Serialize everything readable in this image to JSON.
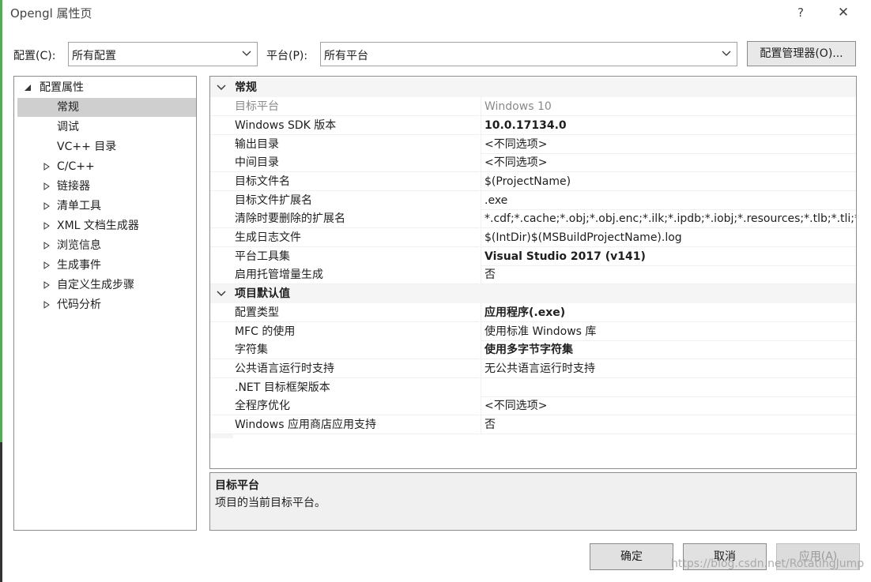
{
  "window": {
    "title": "Opengl 属性页",
    "help_glyph": "?",
    "close_glyph": "✕"
  },
  "config_bar": {
    "config_label": "配置(C):",
    "config_value": "所有配置",
    "platform_label": "平台(P):",
    "platform_value": "所有平台",
    "manager_button": "配置管理器(O)..."
  },
  "tree": {
    "root": "配置属性",
    "items": [
      {
        "label": "常规",
        "selected": true,
        "expandable": false
      },
      {
        "label": "调试",
        "selected": false,
        "expandable": false
      },
      {
        "label": "VC++ 目录",
        "selected": false,
        "expandable": false
      },
      {
        "label": "C/C++",
        "selected": false,
        "expandable": true
      },
      {
        "label": "链接器",
        "selected": false,
        "expandable": true
      },
      {
        "label": "清单工具",
        "selected": false,
        "expandable": true
      },
      {
        "label": "XML 文档生成器",
        "selected": false,
        "expandable": true
      },
      {
        "label": "浏览信息",
        "selected": false,
        "expandable": true
      },
      {
        "label": "生成事件",
        "selected": false,
        "expandable": true
      },
      {
        "label": "自定义生成步骤",
        "selected": false,
        "expandable": true
      },
      {
        "label": "代码分析",
        "selected": false,
        "expandable": true
      }
    ]
  },
  "properties": {
    "categories": [
      {
        "label": "常规",
        "rows": [
          {
            "name": "目标平台",
            "value": "Windows 10",
            "bold": false,
            "disabled": true
          },
          {
            "name": "Windows SDK 版本",
            "value": "10.0.17134.0",
            "bold": true,
            "disabled": false
          },
          {
            "name": "输出目录",
            "value": "<不同选项>",
            "bold": false,
            "disabled": false
          },
          {
            "name": "中间目录",
            "value": "<不同选项>",
            "bold": false,
            "disabled": false
          },
          {
            "name": "目标文件名",
            "value": "$(ProjectName)",
            "bold": false,
            "disabled": false
          },
          {
            "name": "目标文件扩展名",
            "value": ".exe",
            "bold": false,
            "disabled": false
          },
          {
            "name": "清除时要删除的扩展名",
            "value": "*.cdf;*.cache;*.obj;*.obj.enc;*.ilk;*.ipdb;*.iobj;*.resources;*.tlb;*.tli;*.t",
            "bold": false,
            "disabled": false
          },
          {
            "name": "生成日志文件",
            "value": "$(IntDir)$(MSBuildProjectName).log",
            "bold": false,
            "disabled": false
          },
          {
            "name": "平台工具集",
            "value": "Visual Studio 2017 (v141)",
            "bold": true,
            "disabled": false
          },
          {
            "name": "启用托管增量生成",
            "value": "否",
            "bold": false,
            "disabled": false
          }
        ]
      },
      {
        "label": "项目默认值",
        "rows": [
          {
            "name": "配置类型",
            "value": "应用程序(.exe)",
            "bold": true,
            "disabled": false
          },
          {
            "name": "MFC 的使用",
            "value": "使用标准 Windows 库",
            "bold": false,
            "disabled": false
          },
          {
            "name": "字符集",
            "value": "使用多字节字符集",
            "bold": true,
            "disabled": false
          },
          {
            "name": "公共语言运行时支持",
            "value": "无公共语言运行时支持",
            "bold": false,
            "disabled": false
          },
          {
            "name": ".NET 目标框架版本",
            "value": "",
            "bold": false,
            "disabled": false
          },
          {
            "name": "全程序优化",
            "value": "<不同选项>",
            "bold": false,
            "disabled": false
          },
          {
            "name": "Windows 应用商店应用支持",
            "value": "否",
            "bold": false,
            "disabled": false
          }
        ]
      }
    ]
  },
  "description": {
    "title": "目标平台",
    "text": "项目的当前目标平台。"
  },
  "buttons": {
    "ok": "确定",
    "cancel": "取消",
    "apply": "应用(A)"
  },
  "watermark": "https://blog.csdn.net/RotatingJump",
  "colors": {
    "selected_tree_bg": "#cfcfcf",
    "category_bg": "#f5f5f5",
    "desc_bg": "#f0f0f0",
    "window_edge": "#4caf50"
  }
}
